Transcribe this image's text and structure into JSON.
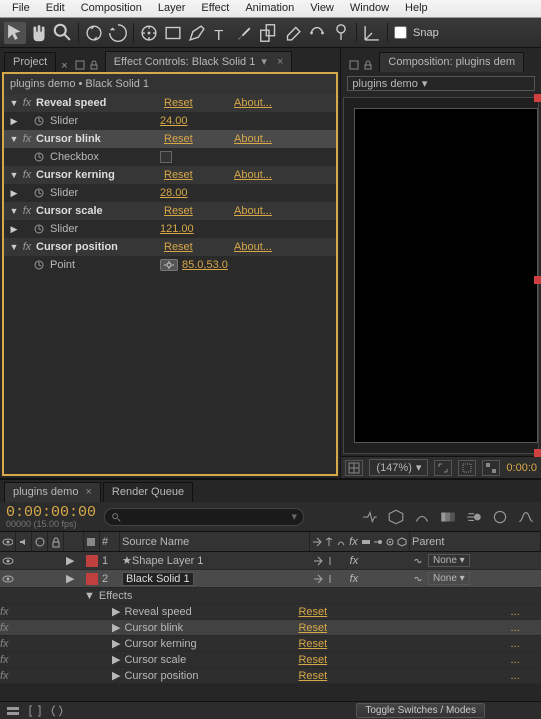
{
  "menu": [
    "File",
    "Edit",
    "Composition",
    "Layer",
    "Effect",
    "Animation",
    "View",
    "Window",
    "Help"
  ],
  "snap_label": "Snap",
  "tabs": {
    "project": "Project",
    "effect_controls_prefix": "Effect Controls: ",
    "effect_controls_layer": "Black Solid 1"
  },
  "comp_tab_prefix": "Composition: ",
  "comp_tab_name": "plugins dem",
  "comp_crumb": "plugins demo",
  "breadcrumb_comp": "plugins demo",
  "breadcrumb_layer": "Black Solid 1",
  "reset_label": "Reset",
  "about_label": "About...",
  "effects": [
    {
      "name": "Reveal speed",
      "sub": "Slider",
      "val": "24.00",
      "sel": false,
      "type": "slider"
    },
    {
      "name": "Cursor blink",
      "sub": "Checkbox",
      "val": "",
      "sel": true,
      "type": "checkbox"
    },
    {
      "name": "Cursor kerning",
      "sub": "Slider",
      "val": "28.00",
      "sel": false,
      "type": "slider"
    },
    {
      "name": "Cursor scale",
      "sub": "Slider",
      "val": "121.00",
      "sel": false,
      "type": "slider"
    },
    {
      "name": "Cursor position",
      "sub": "Point",
      "val": "85.0,53.0",
      "sel": false,
      "type": "point"
    }
  ],
  "zoom": "(147%)",
  "tl_tab": "plugins demo",
  "tl_tab2": "Render Queue",
  "timecode": "0:00:00:00",
  "timecode_sub": "00000 (15.00 fps)",
  "cols": {
    "num": "#",
    "src": "Source Name",
    "parent": "Parent"
  },
  "layers": [
    {
      "num": "1",
      "name": "Shape Layer 1",
      "color": "#c04040",
      "parent": "None",
      "sel": false,
      "star": true
    },
    {
      "num": "2",
      "name": "Black Solid 1",
      "color": "#c04040",
      "parent": "None",
      "sel": true,
      "star": false
    }
  ],
  "effects_label": "Effects",
  "tl_effects": [
    "Reveal speed",
    "Cursor blink",
    "Cursor kerning",
    "Cursor scale",
    "Cursor position"
  ],
  "tl_effects_sel": 1,
  "dots": "...",
  "toggle_label": "Toggle Switches / Modes",
  "comp_time": "0:00:0"
}
